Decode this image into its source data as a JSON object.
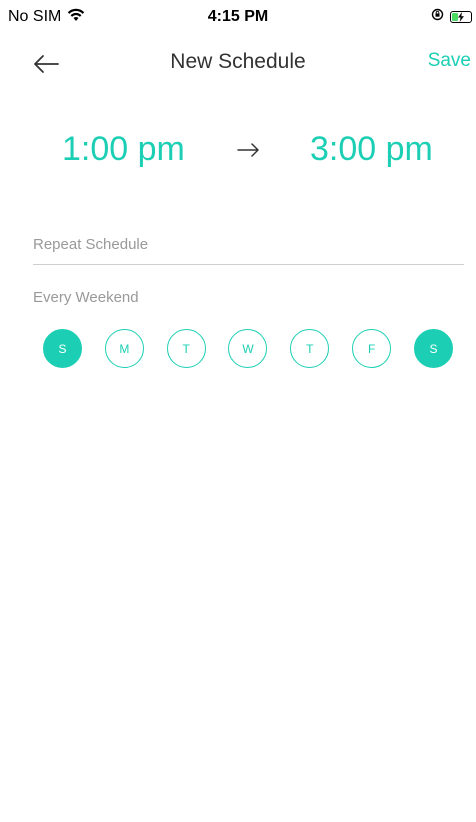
{
  "status_bar": {
    "carrier": "No SIM",
    "time": "4:15 PM",
    "battery_level": 0.35,
    "icons": [
      "wifi-icon",
      "orientation-lock-icon",
      "battery-charging-icon"
    ]
  },
  "nav": {
    "title": "New Schedule",
    "save_label": "Save",
    "back_icon": "back-arrow-icon"
  },
  "schedule": {
    "start_time": "1:00 pm",
    "end_time": "3:00 pm",
    "arrow_icon": "right-arrow-icon"
  },
  "repeat": {
    "label": "Repeat Schedule",
    "value": "Every Weekend"
  },
  "days": [
    {
      "label": "S",
      "selected": true
    },
    {
      "label": "M",
      "selected": false
    },
    {
      "label": "T",
      "selected": false
    },
    {
      "label": "W",
      "selected": false
    },
    {
      "label": "T",
      "selected": false
    },
    {
      "label": "F",
      "selected": false
    },
    {
      "label": "S",
      "selected": true
    }
  ],
  "colors": {
    "accent": "#1ccfb4",
    "text_primary": "#333333",
    "text_secondary": "#999999",
    "divider": "#cfcfcf",
    "battery": "#4cd964"
  }
}
